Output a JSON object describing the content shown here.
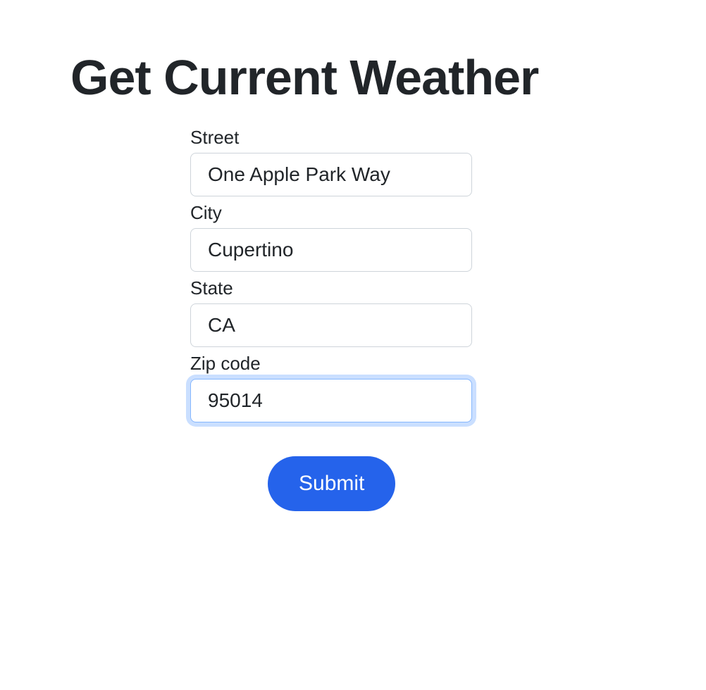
{
  "title": "Get Current Weather",
  "form": {
    "street": {
      "label": "Street",
      "value": "One Apple Park Way"
    },
    "city": {
      "label": "City",
      "value": "Cupertino"
    },
    "state": {
      "label": "State",
      "value": "CA"
    },
    "zip": {
      "label": "Zip code",
      "value": "95014"
    },
    "submit_label": "Submit"
  }
}
